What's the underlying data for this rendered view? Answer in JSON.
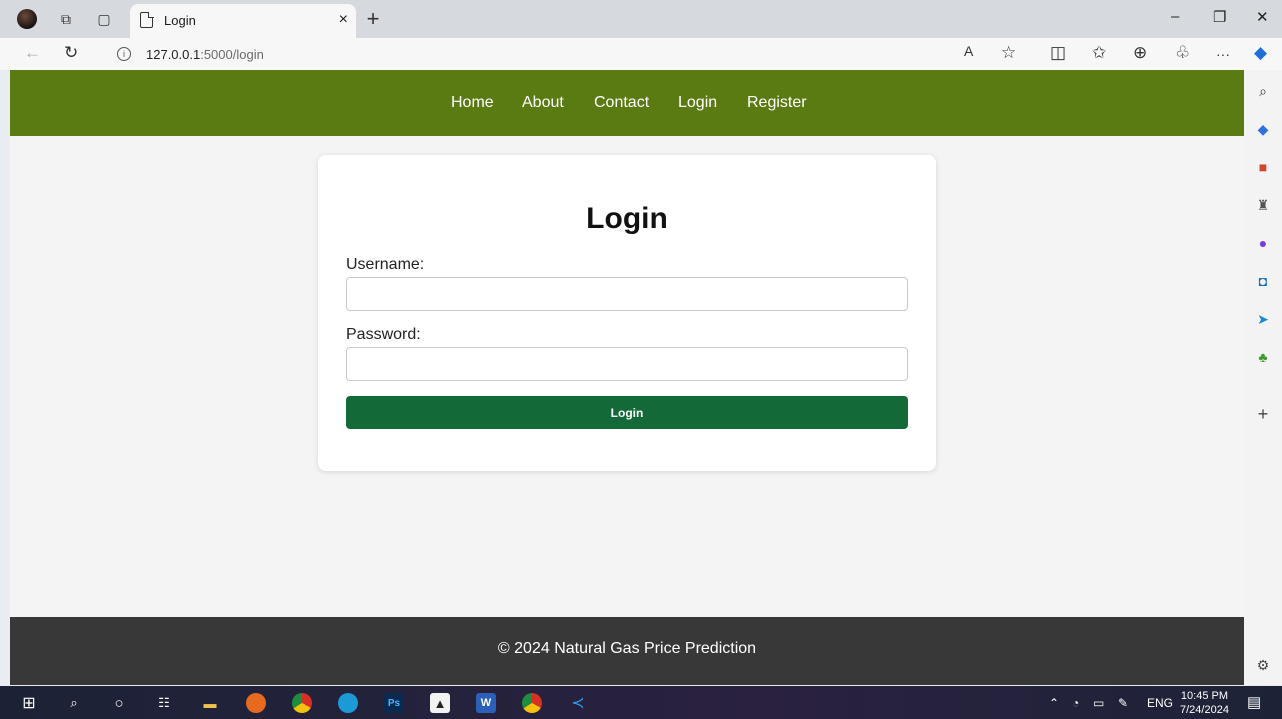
{
  "browser": {
    "tab_title": "Login",
    "tab_close": "×",
    "new_tab": "+",
    "url_host": "127.0.0.1",
    "url_path": ":5000/login",
    "window": {
      "minimize": "–",
      "restore": "❐",
      "close": "✕"
    },
    "more": "···"
  },
  "nav": {
    "items": [
      "Home",
      "About",
      "Contact",
      "Login",
      "Register"
    ]
  },
  "login": {
    "heading": "Login",
    "username_label": "Username:",
    "username_value": "",
    "password_label": "Password:",
    "password_value": "",
    "submit_label": "Login"
  },
  "footer": {
    "text": "© 2024 Natural Gas Price Prediction"
  },
  "taskbar": {
    "language": "ENG",
    "time": "10:45 PM",
    "date": "7/24/2024",
    "ps_label": "Ps"
  },
  "colors": {
    "navbar": "#5a7b12",
    "button": "#136a38",
    "footer": "#383838"
  }
}
